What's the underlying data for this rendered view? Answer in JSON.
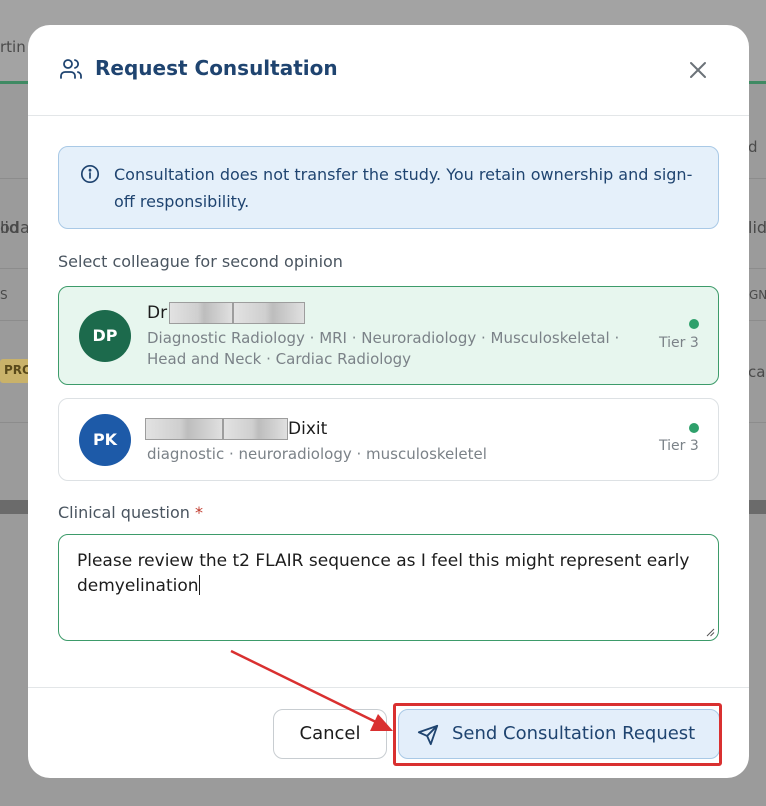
{
  "background": {
    "top_text": "rtin",
    "right_top_text": "d",
    "left_row_text": "oda",
    "right_row_text": "lid",
    "left_col_text": "S",
    "right_col_text": "GN",
    "pill_text": "PRO",
    "right_cell_text": "ca"
  },
  "modal": {
    "title": "Request Consultation",
    "header_icon": "users-icon",
    "close_icon": "close-icon"
  },
  "info": {
    "icon": "info-icon",
    "text": "Consultation does not transfer the study. You retain ownership and sign-off responsibility."
  },
  "colleague_label": "Select colleague for second opinion",
  "colleagues": [
    {
      "initials": "DP",
      "name_prefix": "Dr",
      "name_suffix": "",
      "specialties": "Diagnostic Radiology · MRI · Neuroradiology · Musculoskeletal · Head and Neck · Cardiac Radiology",
      "tier": "Tier 3",
      "online": true,
      "selected": true
    },
    {
      "initials": "PK",
      "name_prefix": "",
      "name_suffix": "Dixit",
      "specialties": "diagnostic · neuroradiology · musculoskeletel",
      "tier": "Tier 3",
      "online": true,
      "selected": false
    }
  ],
  "clinical_question": {
    "label": "Clinical question",
    "required_mark": "*",
    "value": "Please review the t2 FLAIR sequence as I feel this might represent early demyelination"
  },
  "footer": {
    "cancel_label": "Cancel",
    "send_label": "Send Consultation Request",
    "send_icon": "send-icon"
  },
  "colors": {
    "accent": "#1f4470",
    "success": "#3d9b6a",
    "annotation": "#d93030"
  }
}
